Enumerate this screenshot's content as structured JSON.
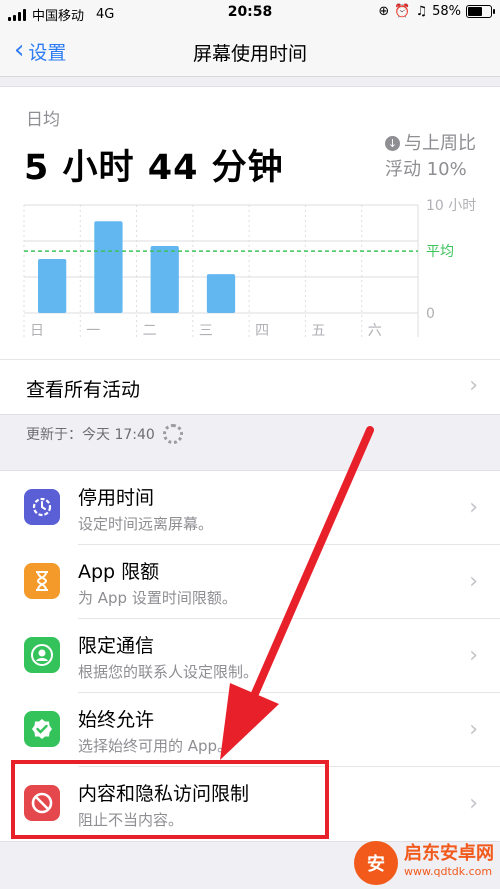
{
  "status_bar": {
    "carrier": "中国移动",
    "network": "4G",
    "time": "20:58",
    "battery": "58%"
  },
  "nav": {
    "back_label": "设置",
    "title": "屏幕使用时间"
  },
  "summary": {
    "daily_avg_label": "日均",
    "daily_avg_value": "5 小时 44 分钟",
    "delta_line1": "与上周比",
    "delta_line2": "浮动 10%"
  },
  "chart_data": {
    "type": "bar",
    "categories": [
      "日",
      "一",
      "二",
      "三",
      "四",
      "五",
      "六"
    ],
    "values": [
      5.0,
      8.5,
      6.2,
      3.6,
      0,
      0,
      0
    ],
    "average": 5.73,
    "ylim": [
      0,
      10
    ],
    "ytick_labels": [
      "10 小时",
      "0"
    ],
    "average_label": "平均",
    "colors": {
      "bar": "#63b7f0",
      "average": "#3cc35a",
      "grid": "#dedee2"
    }
  },
  "see_all": "查看所有活动",
  "updated": "更新于：今天 17:40",
  "settings": [
    {
      "title": "停用时间",
      "sub": "设定时间远离屏幕。",
      "color": "#5a5fd6",
      "icon": "downtime-icon"
    },
    {
      "title": "App 限额",
      "sub": "为 App 设置时间限额。",
      "color": "#f39a2b",
      "icon": "hourglass-icon"
    },
    {
      "title": "限定通信",
      "sub": "根据您的联系人设定限制。",
      "color": "#34c35b",
      "icon": "contact-icon"
    },
    {
      "title": "始终允许",
      "sub": "选择始终可用的 App。",
      "color": "#34c35b",
      "icon": "checkmark-badge-icon"
    },
    {
      "title": "内容和隐私访问限制",
      "sub": "阻止不当内容。",
      "color": "#e5484c",
      "icon": "restriction-icon"
    }
  ],
  "watermark": {
    "name": "启东安卓网",
    "url": "www.qdtdk.com"
  }
}
